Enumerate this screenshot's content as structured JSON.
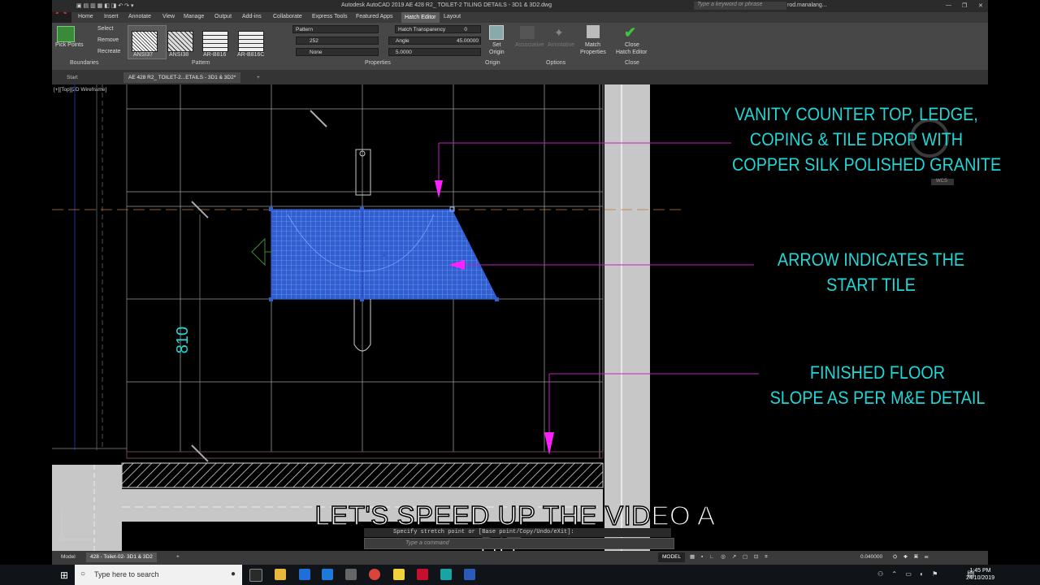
{
  "app": {
    "logo_letter": "A",
    "title": "Autodesk AutoCAD 2019   AE 428 R2_ TOILET-2 TILING DETAILS - 3D1 & 3D2.dwg",
    "search_placeholder": "Type a keyword or phrase",
    "user": "rod.manalang..."
  },
  "ribbon_tabs": [
    "Home",
    "Insert",
    "Annotate",
    "View",
    "Manage",
    "Output",
    "Add-ins",
    "Collaborate",
    "Express Tools",
    "Featured Apps",
    "Hatch Editor",
    "Layout"
  ],
  "active_tab": "Hatch Editor",
  "ribbon": {
    "boundaries": {
      "pick_points": "Pick Points",
      "select": "Select",
      "remove": "Remove",
      "recreate": "Recreate",
      "title": "Boundaries"
    },
    "pattern": {
      "items": [
        "ANSI37",
        "ANSI38",
        "AR-B816",
        "AR-B816C"
      ],
      "title": "Pattern"
    },
    "properties": {
      "type": "Pattern",
      "color": "252",
      "bg": "None",
      "transparency_label": "Hatch Transparency",
      "transparency": "0",
      "angle_label": "Angle",
      "angle": "45.00000",
      "scale": "5.0000",
      "title": "Properties"
    },
    "origin": {
      "set_origin_line1": "Set",
      "set_origin_line2": "Origin",
      "title": "Origin"
    },
    "options": {
      "associative": "Associative",
      "annotative": "Annotative",
      "match_line1": "Match",
      "match_line2": "Properties",
      "title": "Options"
    },
    "close": {
      "line1": "Close",
      "line2": "Hatch Editor",
      "title": "Close"
    }
  },
  "file_tabs": {
    "start": "Start",
    "active": "AE 428 R2_ TOILET-2...ETAILS - 3D1 & 3D2*"
  },
  "viewport_label": "[+][Top][2D Wireframe]",
  "annotations": {
    "vanity_lines": [
      "VANITY COUNTER TOP, LEDGE,",
      "COPING & TILE DROP WITH",
      "COPPER SILK POLISHED GRANITE"
    ],
    "arrow_lines": [
      "ARROW INDICATES THE",
      "START TILE"
    ],
    "floor_lines": [
      "FINISHED FLOOR",
      "SLOPE AS PER M&E DETAIL"
    ],
    "dimension": "810",
    "wcs": "WCS"
  },
  "caption": "LET'S SPEED UP THE VIDEO A BIT....",
  "command": {
    "history": "Specify stretch point or [Base point/Copy/Undo/eXit]:",
    "placeholder": "Type a command"
  },
  "layout_tabs": [
    "Model",
    "428 - Toilet-02- 3D1 & 3D2"
  ],
  "status": {
    "mode": "MODEL",
    "scale": "0.040000"
  },
  "taskbar": {
    "search": "Type here to search",
    "time": "1:45 PM",
    "date": "24/10/2019"
  },
  "colors": {
    "annotation": "#21d6d6",
    "hatch": "#2f5fd0",
    "leader": "#c020c0",
    "arrow": "#ff20ff"
  }
}
